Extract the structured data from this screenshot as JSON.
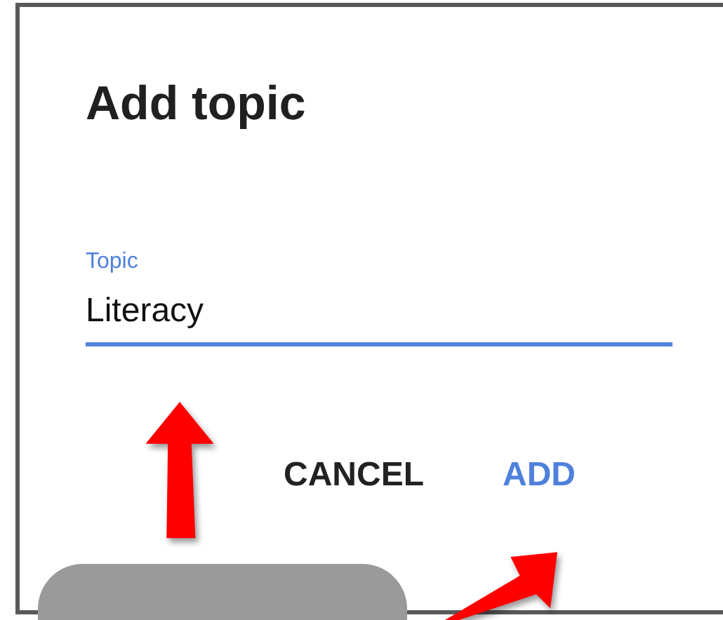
{
  "dialog": {
    "title": "Add topic",
    "field": {
      "label": "Topic",
      "value": "Literacy",
      "focused": true
    },
    "buttons": [
      {
        "label": "CANCEL",
        "kind": "secondary"
      },
      {
        "label": "ADD",
        "kind": "primary"
      }
    ]
  },
  "toast": {
    "kind": "snackbar"
  }
}
